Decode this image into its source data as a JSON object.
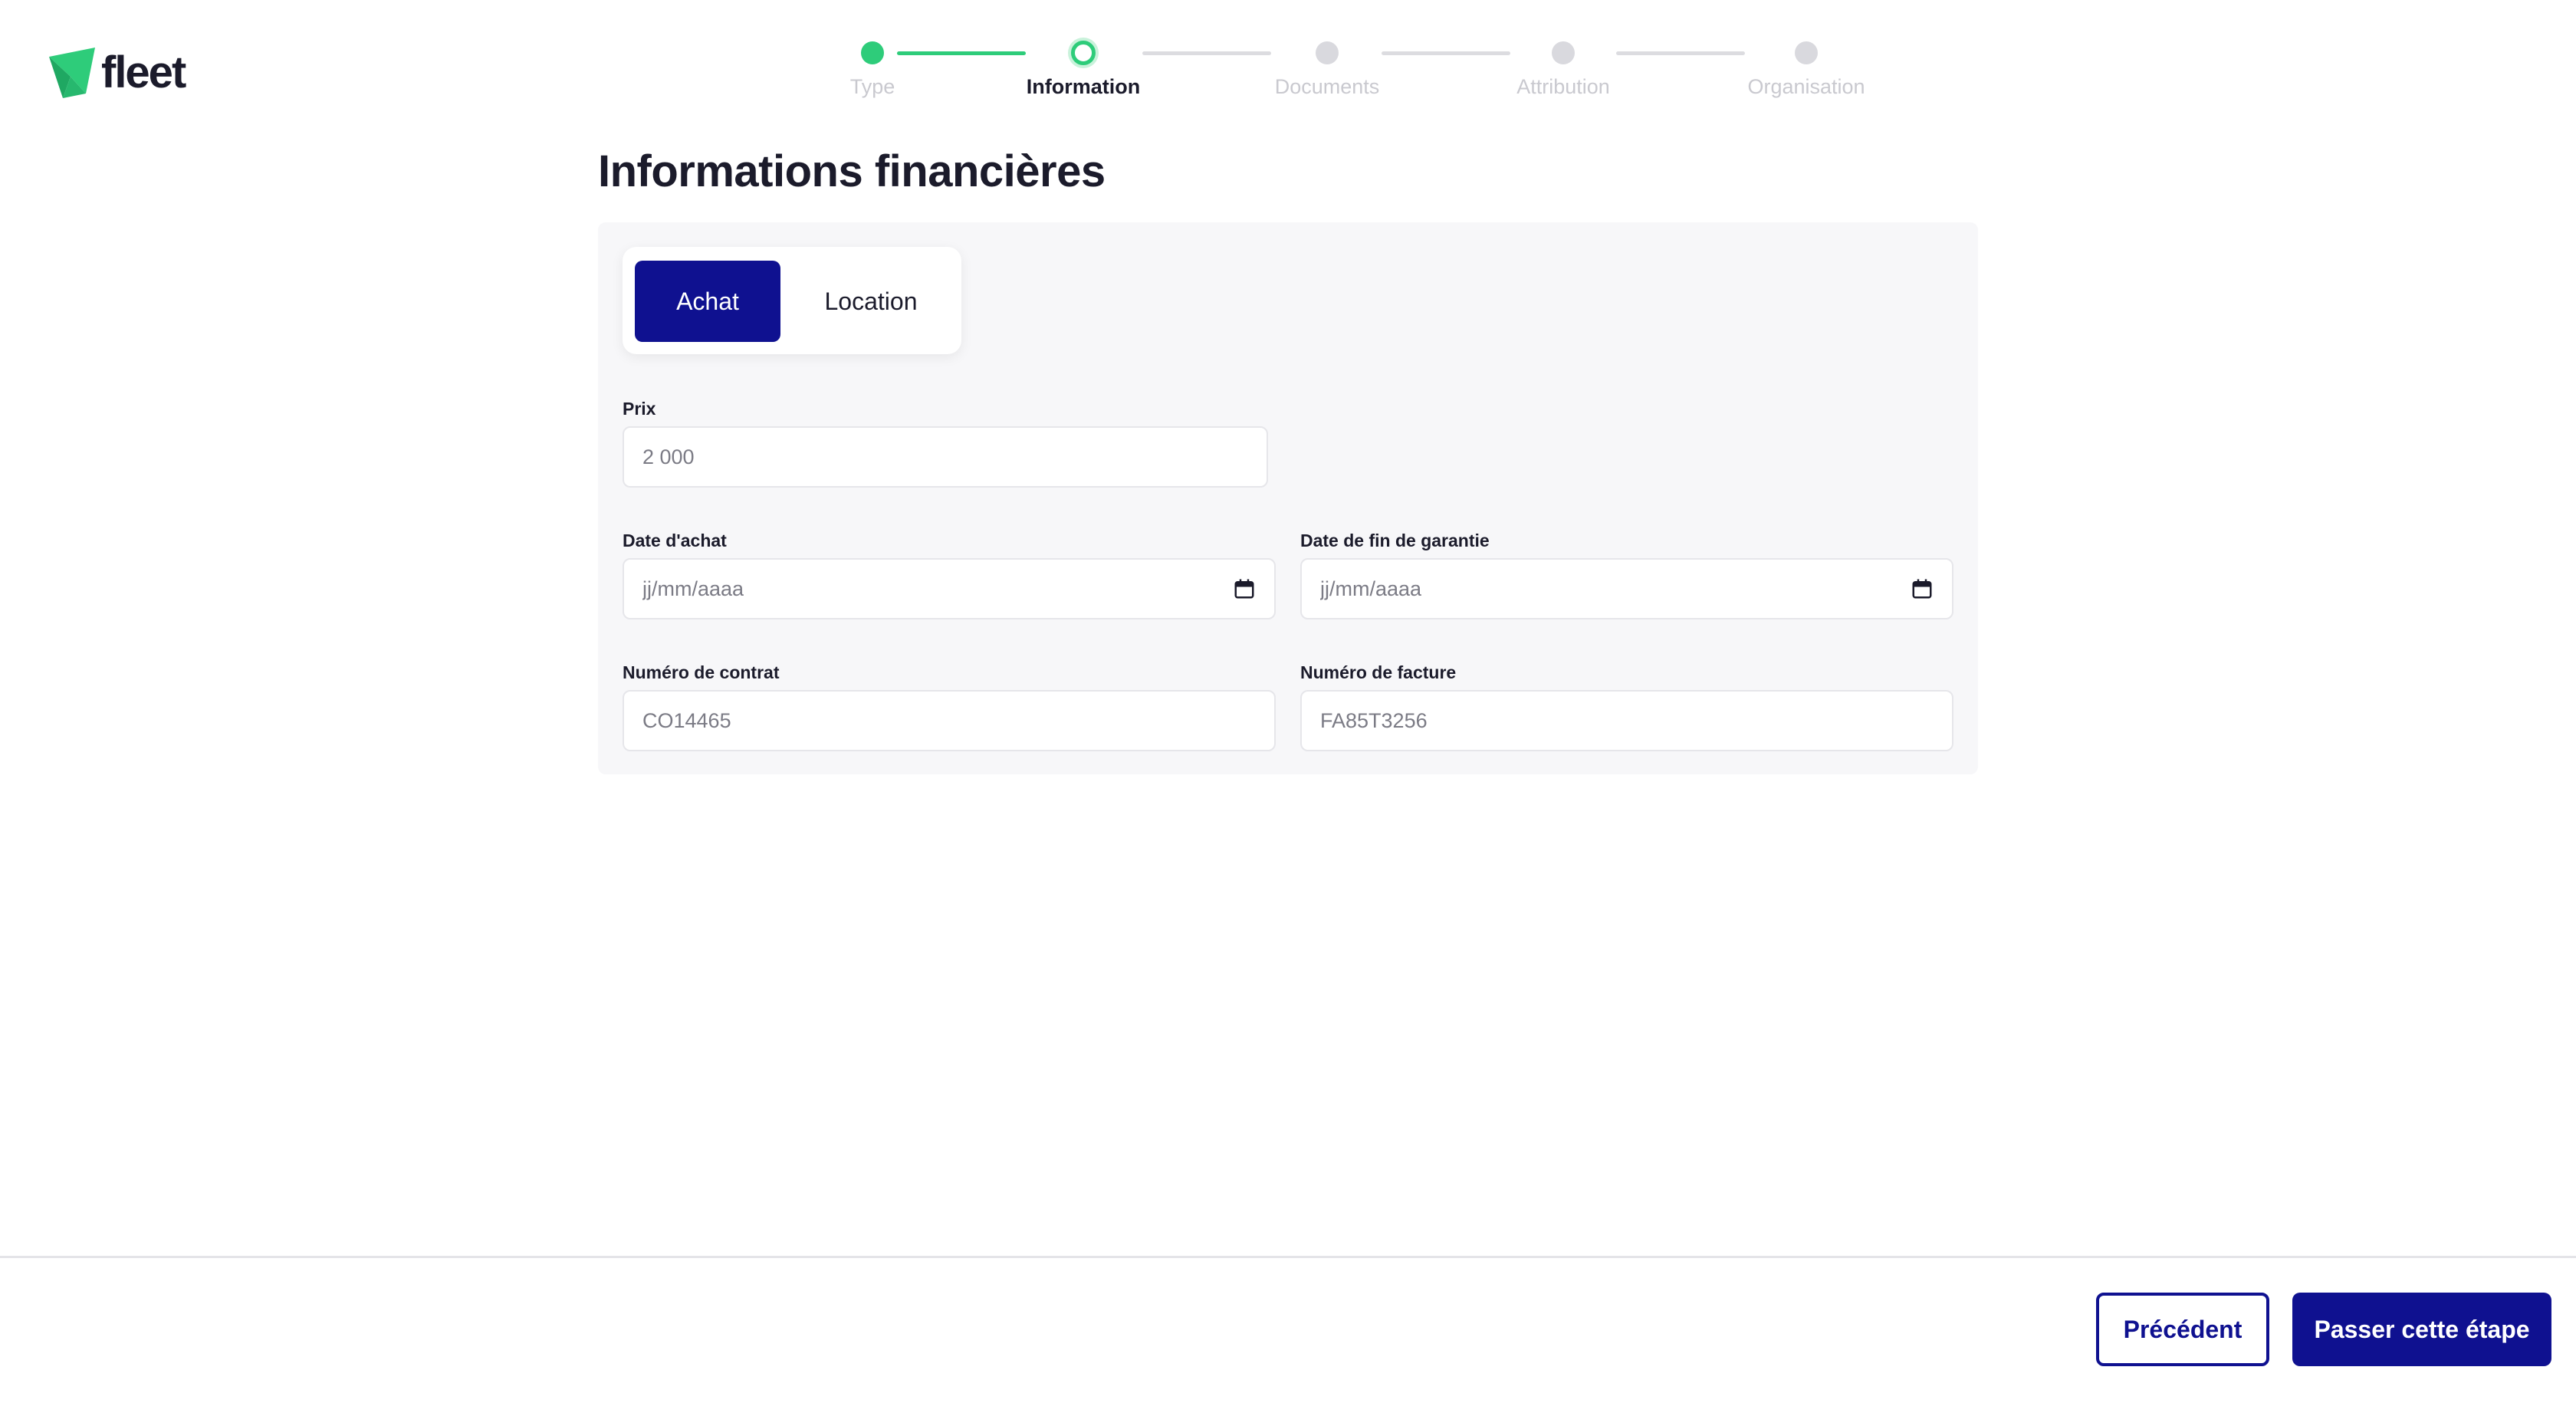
{
  "logo": {
    "text": "fleet",
    "icon": "fleet-logo-icon",
    "color": "#2ecc7a"
  },
  "stepper": {
    "steps": [
      {
        "label": "Type",
        "state": "done"
      },
      {
        "label": "Information",
        "state": "current"
      },
      {
        "label": "Documents",
        "state": "upcoming"
      },
      {
        "label": "Attribution",
        "state": "upcoming"
      },
      {
        "label": "Organisation",
        "state": "upcoming"
      }
    ]
  },
  "page": {
    "title": "Informations financières"
  },
  "toggle": {
    "achat_label": "Achat",
    "location_label": "Location",
    "selected": "Achat"
  },
  "form": {
    "prix": {
      "label": "Prix",
      "value": "2 000"
    },
    "date_achat": {
      "label": "Date d'achat",
      "placeholder": "jj/mm/aaaa"
    },
    "date_fin_garantie": {
      "label": "Date de fin de garantie",
      "placeholder": "jj/mm/aaaa"
    },
    "numero_contrat": {
      "label": "Numéro de contrat",
      "value": "CO14465"
    },
    "numero_facture": {
      "label": "Numéro de facture",
      "value": "FA85T3256"
    }
  },
  "footer": {
    "previous_label": "Précédent",
    "skip_label": "Passer cette étape"
  },
  "colors": {
    "primary": "#0f1190",
    "success": "#2ecc7a",
    "card_bg": "#f7f7f9"
  }
}
